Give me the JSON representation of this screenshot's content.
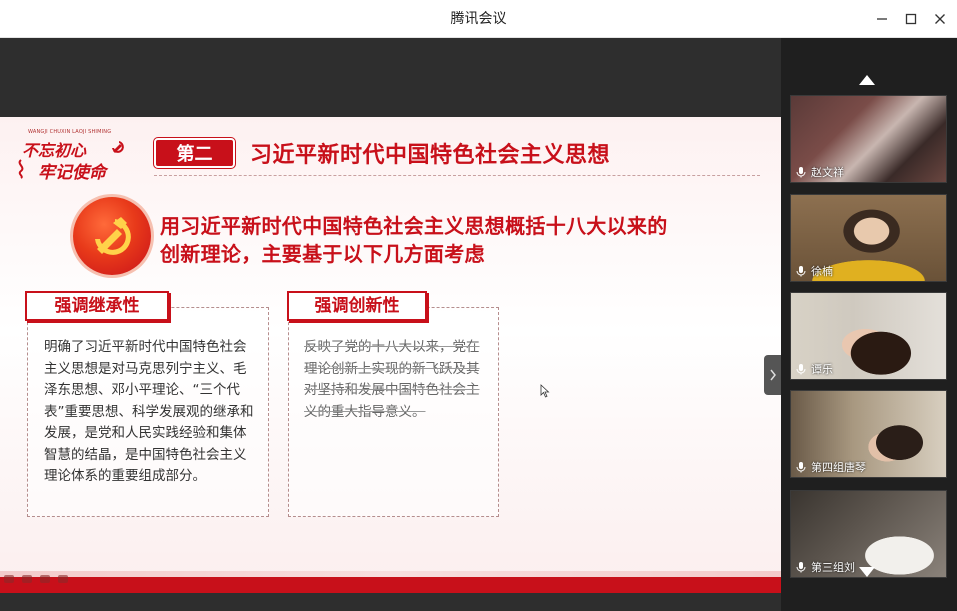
{
  "window": {
    "title": "腾讯会议"
  },
  "colors": {
    "accent_red": "#c8101a",
    "panel_bg": "#1f1f1f",
    "share_bg": "#2e2e2e"
  },
  "icons": {
    "minimize": "minimize-icon",
    "maximize": "maximize-icon",
    "close": "close-icon",
    "scroll_up": "triangle-up-icon",
    "scroll_down": "triangle-down-icon",
    "collapse": "chevron-right-icon",
    "mic": "mic-icon",
    "emblem": "hammer-sickle-icon"
  },
  "slide": {
    "logo": {
      "small_caption": "WANGJI CHUXIN LAOJI SHIMING",
      "line1": "不忘初心",
      "line2": "牢记使命"
    },
    "badge": "第二",
    "heading": "习近平新时代中国特色社会主义思想",
    "subheading": "用习近平新时代中国特色社会主义思想概括十八大以来的创新理论，主要基于以下几方面考虑",
    "cards": [
      {
        "title": "强调继承性",
        "body": "明确了习近平新时代中国特色社会主义思想是对马克思列宁主义、毛泽东思想、邓小平理论、“三个代表”重要思想、科学发展观的继承和发展，是党和人民实践经验和集体智慧的结晶，是中国特色社会主义理论体系的重要组成部分。"
      },
      {
        "title": "强调创新性",
        "body": "反映了党的十八大以来，党在理论创新上实现的新飞跃及其对坚持和发展中国特色社会主义的重大指导意义。"
      }
    ]
  },
  "participants": [
    {
      "name": "赵文祥"
    },
    {
      "name": "徐楠"
    },
    {
      "name": "谭乐"
    },
    {
      "name": "第四组唐琴"
    },
    {
      "name": "第三组刘"
    }
  ]
}
